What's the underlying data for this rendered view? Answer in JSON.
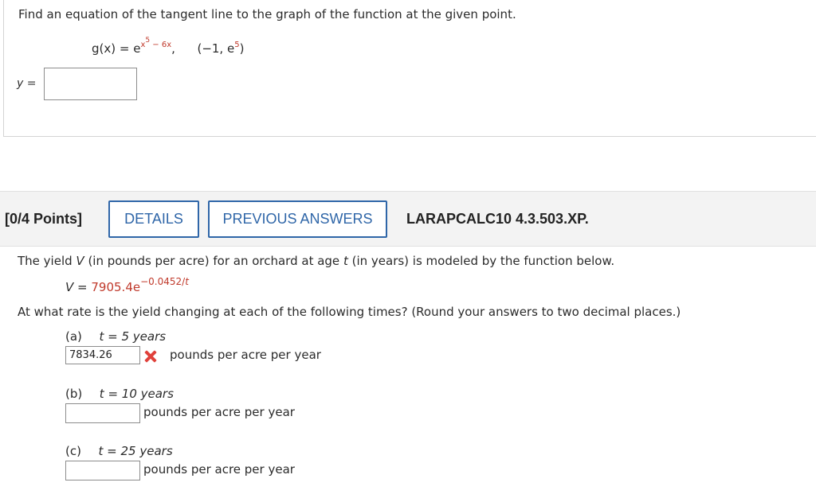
{
  "problem1": {
    "prompt": "Find an equation of the tangent line to the graph of the function at the given point.",
    "function_lhs": "g(x) = e",
    "exp_base": "x",
    "exp_power": "5",
    "exp_tail": " − 6x",
    "comma": ",",
    "point_open": "(−1, e",
    "point_power": "5",
    "point_close": ")",
    "answer_label": "y =",
    "answer_value": ""
  },
  "problem2": {
    "points": "[0/4 Points]",
    "details_label": "DETAILS",
    "previous_answers_label": "PREVIOUS ANSWERS",
    "problem_id": "LARAPCALC10 4.3.503.XP.",
    "intro_a": "The yield ",
    "intro_var_v": "V",
    "intro_b": " (in pounds per acre) for an orchard at age ",
    "intro_var_t": "t",
    "intro_c": " (in years) is modeled by the function below.",
    "formula_lhs": "V = ",
    "formula_coef": "7905.4e",
    "formula_exp": "−0.0452/",
    "formula_exp_t": "t",
    "question": "At what rate is the yield changing at each of the following times? (Round your answers to two decimal places.)",
    "parts": [
      {
        "label": "(a)",
        "t_text": "t = 5 years",
        "value": "7834.26",
        "unit": "pounds per acre per year"
      },
      {
        "label": "(b)",
        "t_text": "t = 10 years",
        "value": "",
        "unit": "pounds per acre per year"
      },
      {
        "label": "(c)",
        "t_text": "t = 25 years",
        "value": "",
        "unit": "pounds per acre per year"
      }
    ],
    "incorrect_color": "#e0413b",
    "accent_color": "#2f66a8"
  }
}
